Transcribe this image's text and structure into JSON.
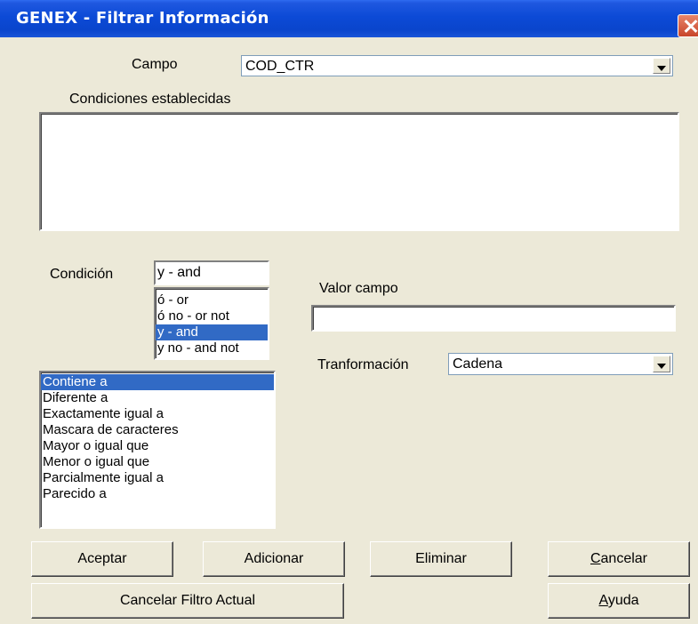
{
  "window": {
    "title": "GENEX - Filtrar Información"
  },
  "campo": {
    "label": "Campo",
    "value": "COD_CTR"
  },
  "condiciones": {
    "label": "Condiciones establecidas"
  },
  "condicion": {
    "label": "Condición",
    "value": "y - and",
    "options": [
      "ó - or",
      "ó no - or not",
      "y - and",
      "y no - and not"
    ],
    "selected_index": 2
  },
  "valor_campo": {
    "label": "Valor campo",
    "value": ""
  },
  "transformacion": {
    "label": "Tranformación",
    "value": "Cadena"
  },
  "operadores": {
    "items": [
      "Contiene a",
      "Diferente a",
      "Exactamente igual a",
      "Mascara de caracteres",
      "Mayor o igual que",
      "Menor o igual que",
      "Parcialmente igual a",
      "Parecido a"
    ],
    "selected_index": 0
  },
  "buttons": {
    "aceptar": "Aceptar",
    "adicionar": "Adicionar",
    "eliminar": "Eliminar",
    "cancelar_first": "C",
    "cancelar_rest": "ancelar",
    "cancelar_filtro": "Cancelar Filtro Actual",
    "ayuda_first": "A",
    "ayuda_rest": "yuda"
  },
  "colors": {
    "titlebar": "#0a45cc",
    "selection": "#316ac5",
    "dialog_bg": "#ece9d8"
  }
}
